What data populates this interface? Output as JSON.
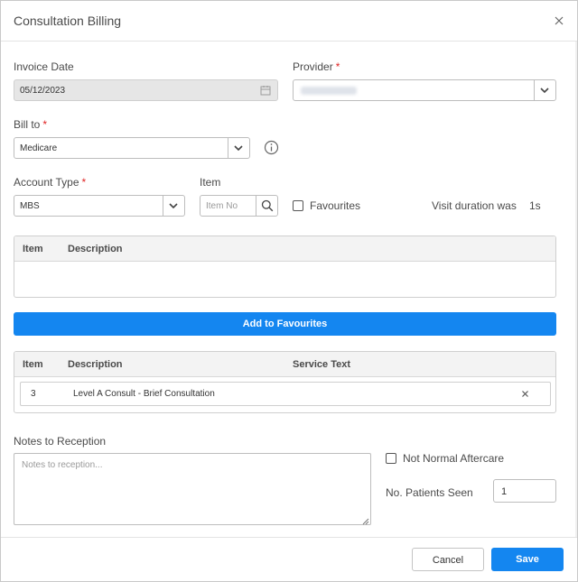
{
  "dialog": {
    "title": "Consultation Billing"
  },
  "form": {
    "invoice_date_label": "Invoice Date",
    "invoice_date_value": "05/12/2023",
    "provider_label": "Provider",
    "provider_value": "",
    "bill_to_label": "Bill to",
    "bill_to_value": "Medicare",
    "account_type_label": "Account Type",
    "account_type_value": "MBS",
    "item_label": "Item",
    "item_placeholder": "Item No",
    "favourites_label": "Favourites",
    "visit_duration_label": "Visit duration was",
    "visit_duration_value": "1s",
    "required_mark": "*"
  },
  "search_grid": {
    "columns": [
      "Item",
      "Description"
    ]
  },
  "add_to_favourites_label": "Add to Favourites",
  "selected_grid": {
    "columns": [
      "Item",
      "Description",
      "Service Text"
    ],
    "rows": [
      {
        "item": "3",
        "description": "Level A Consult - Brief Consultation",
        "service_text": ""
      }
    ]
  },
  "notes": {
    "label": "Notes to Reception",
    "placeholder": "Notes to reception..."
  },
  "not_normal_aftercare_label": "Not Normal Aftercare",
  "patients_seen": {
    "label": "No. Patients Seen",
    "value": "1"
  },
  "footer": {
    "cancel_label": "Cancel",
    "save_label": "Save"
  },
  "colors": {
    "primary": "#1486f0",
    "required": "#e02424"
  }
}
